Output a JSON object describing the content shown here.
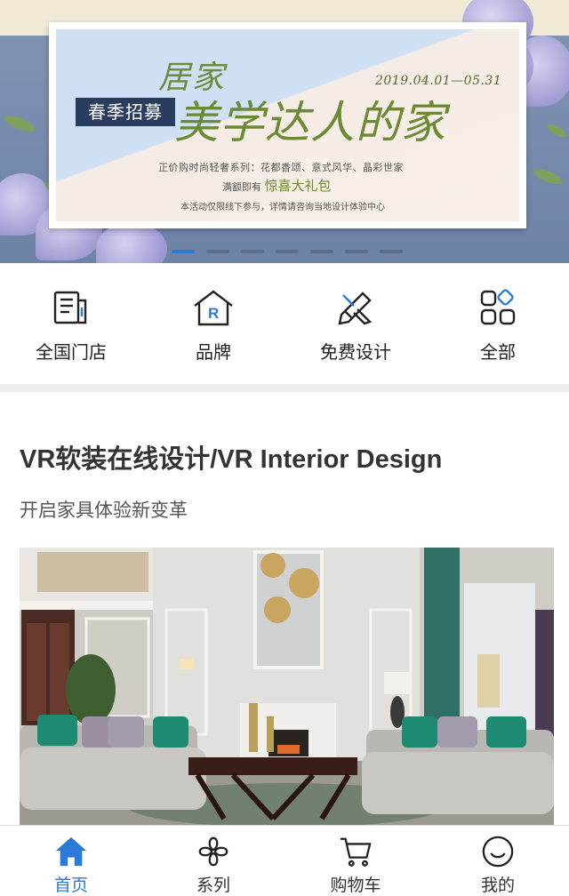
{
  "banner": {
    "tag": "春季招募",
    "title_line1": "居家",
    "title_line2": "美学达人的家",
    "date": "2019.04.01—05.31",
    "line1": "正价购时尚轻奢系列：花都香颂、意式风华、晶彩世家",
    "line2_prefix": "满额即有",
    "line2_highlight": "惊喜大礼包",
    "line3": "本活动仅限线下参与，详情请咨询当地设计体验中心",
    "slide_count": 7,
    "active_slide": 1
  },
  "quicknav": [
    {
      "label": "全国门店",
      "icon": "store-list-icon"
    },
    {
      "label": "品牌",
      "icon": "brand-house-icon"
    },
    {
      "label": "免费设计",
      "icon": "design-tools-icon"
    },
    {
      "label": "全部",
      "icon": "all-grid-icon"
    }
  ],
  "section": {
    "title": "VR软装在线设计/VR Interior Design",
    "subtitle": "开启家具体验新变革"
  },
  "tabbar": [
    {
      "label": "首页",
      "icon": "home-icon",
      "active": true
    },
    {
      "label": "系列",
      "icon": "series-icon",
      "active": false
    },
    {
      "label": "购物车",
      "icon": "cart-icon",
      "active": false
    },
    {
      "label": "我的",
      "icon": "profile-smile-icon",
      "active": false
    }
  ],
  "colors": {
    "accent": "#2b7ad9",
    "banner_green": "#6a8a34",
    "banner_navy": "#2b3d5f"
  }
}
